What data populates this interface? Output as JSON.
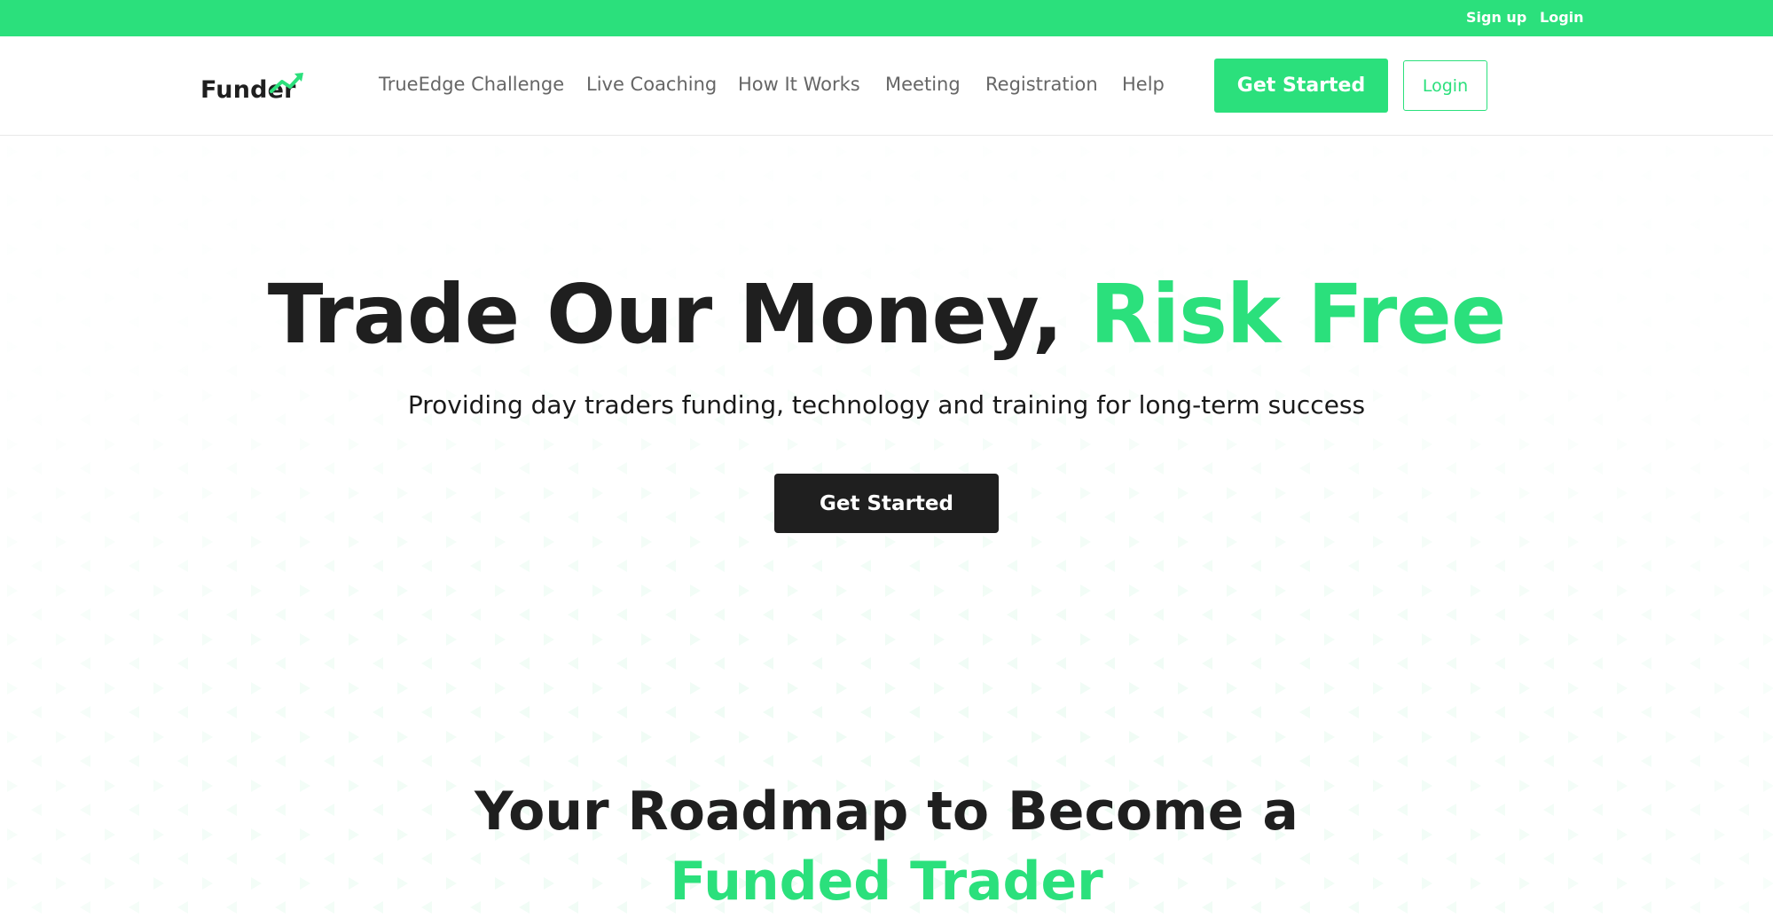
{
  "colors": {
    "brand_green": "#2be07c",
    "dark": "#1f1f1f",
    "nav_text": "#666666",
    "white": "#ffffff"
  },
  "topbar": {
    "signup_label": "Sign up",
    "login_label": "Login"
  },
  "header": {
    "logo_text": "Funder",
    "logo_icon": "trend-arrow-icon",
    "nav_items": [
      {
        "label": "TrueEdge Challenge"
      },
      {
        "label": "Live Coaching"
      },
      {
        "label": "How It Works"
      },
      {
        "label": "Meeting"
      },
      {
        "label": "Registration"
      },
      {
        "label": "Help"
      }
    ],
    "get_started_label": "Get Started",
    "login_label": "Login"
  },
  "hero": {
    "title_main": "Trade Our Money, ",
    "title_accent": "Risk Free",
    "subtitle": "Providing day traders funding, technology and training for long-term success",
    "cta_label": "Get Started"
  },
  "roadmap": {
    "line1": "Your Roadmap to Become a",
    "line2": "Funded Trader"
  }
}
